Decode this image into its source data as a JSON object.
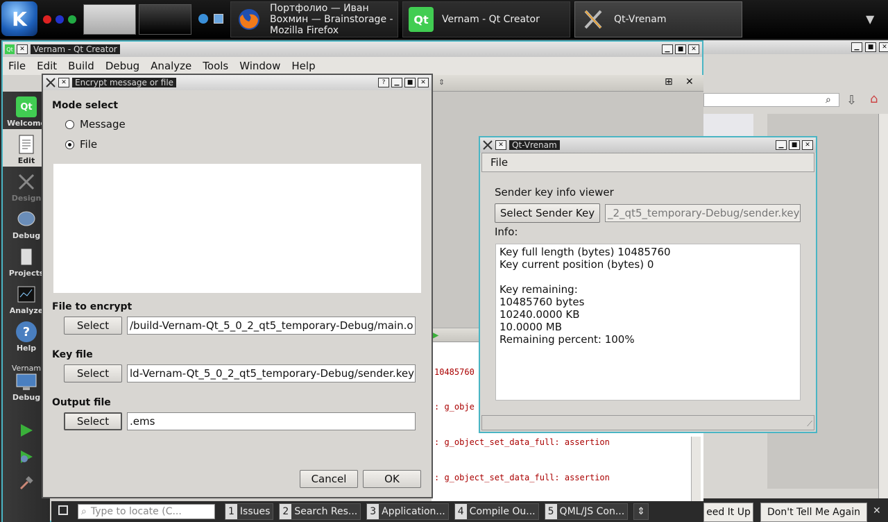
{
  "taskbar": {
    "tasks": [
      {
        "label": "Портфолио — Иван\nВохмин — Brainstorage -\nMozilla Firefox"
      },
      {
        "label": "Vernam - Qt Creator"
      },
      {
        "label": "Qt-Vrenam"
      }
    ]
  },
  "qtcreator": {
    "title": "Vernam - Qt Creator",
    "menu": [
      "File",
      "Edit",
      "Build",
      "Debug",
      "Analyze",
      "Tools",
      "Window",
      "Help"
    ],
    "modes": [
      {
        "label": "Welcome"
      },
      {
        "label": "Edit"
      },
      {
        "label": "Design"
      },
      {
        "label": "Debug"
      },
      {
        "label": "Projects"
      },
      {
        "label": "Analyze"
      },
      {
        "label": "Help"
      }
    ],
    "project_label": "Vernam",
    "project_mode": "Debug",
    "output_lines": [
      "10485760",
      ": g_obje",
      ": g_object_set_data_full: assertion",
      ": g_object_set_data_full: assertion"
    ],
    "locator_placeholder": "Type to locate (C...",
    "output_tabs": [
      {
        "num": "1",
        "label": "Issues"
      },
      {
        "num": "2",
        "label": "Search Res..."
      },
      {
        "num": "3",
        "label": "Application..."
      },
      {
        "num": "4",
        "label": "Compile Ou..."
      },
      {
        "num": "5",
        "label": "QML/JS Con..."
      }
    ]
  },
  "bg_notifications": {
    "speed_label": "eed It Up",
    "dont_tell_label": "Don't Tell Me Again"
  },
  "encrypt_dialog": {
    "title": "Encrypt message or file",
    "mode_select_label": "Mode select",
    "mode_options": [
      {
        "label": "Message",
        "checked": false
      },
      {
        "label": "File",
        "checked": true
      }
    ],
    "file_to_encrypt_label": "File to encrypt",
    "file_to_encrypt_value": "/build-Vernam-Qt_5_0_2_qt5_temporary-Debug/main.o",
    "key_file_label": "Key file",
    "key_file_value": "ld-Vernam-Qt_5_0_2_qt5_temporary-Debug/sender.key",
    "output_file_label": "Output file",
    "output_file_value": ".ems",
    "select_label": "Select",
    "cancel_label": "Cancel",
    "ok_label": "OK"
  },
  "vrenam": {
    "title": "Qt-Vrenam",
    "menu_file": "File",
    "viewer_label": "Sender key info viewer",
    "select_sender_key_label": "Select Sender Key",
    "sender_key_path": "_2_qt5_temporary-Debug/sender.key",
    "info_label": "Info:",
    "info_text": "Key full length (bytes) 10485760\nKey current position (bytes) 0\n\nKey remaining:\n10485760 bytes\n10240.0000 KB\n10.0000 MB\nRemaining percent: 100%"
  },
  "colors": {
    "active_border": "#4ab5c4",
    "output_text": "#aa0000",
    "mode_bar": "#2a2a2a"
  }
}
